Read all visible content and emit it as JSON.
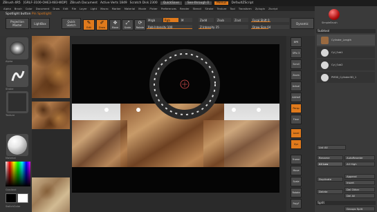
{
  "title_bar": {
    "app": "ZBrush 4R5",
    "doc_info": "[GRLF-3100-OHE3-X83-WDP]",
    "document": "ZBrush Document",
    "active_verts": "Active Verts 1849",
    "scratch": "Scratch Disk 2300",
    "quicksave": "QuickSave",
    "see_through": "See-through 0",
    "menus": "Menus",
    "script": "DefaultZScript"
  },
  "menu_items": [
    "Alpha",
    "Brush",
    "Color",
    "Document",
    "Draw",
    "Edit",
    "File",
    "Layer",
    "Light",
    "Macro",
    "Marker",
    "Material",
    "Movie",
    "Picker",
    "Preferences",
    "Render",
    "Stencil",
    "Stroke",
    "Texture",
    "Tool",
    "Transform",
    "Zplugin",
    "Zscript"
  ],
  "shelf": {
    "title": "Spotlight button",
    "title_highlight": "Pin Spotlight",
    "projection": "Projection Master",
    "lightbox": "LightBox",
    "quick_sketch": "Quick Sketch",
    "tools": [
      {
        "label": "Edit",
        "icon": "✎",
        "on": true
      },
      {
        "label": "Draw",
        "icon": "✐",
        "on": true
      },
      {
        "label": "Move",
        "icon": "✥",
        "on": false
      },
      {
        "label": "Scale",
        "icon": "⤢",
        "on": false
      },
      {
        "label": "Rotate",
        "icon": "⟳",
        "on": false
      }
    ],
    "rgb_label": "Mrgb",
    "rgb_value": "Rgb",
    "m_label": "M",
    "zadd": "Zadd",
    "zsub": "Zsub",
    "zcut": "Zcut",
    "rgb_intensity": "Rgb Intensity 100",
    "z_intensity": "Z Intensity 25",
    "focal_shift": "Focal Shift 0",
    "draw_size": "Draw Size 64",
    "dynamic": "Dynamic"
  },
  "left_tray": {
    "alpha_label": "Alpha",
    "stroke_label": "Stroke",
    "texture_label": "Texture",
    "material_label": "Material",
    "gradient_label": "Gradient",
    "switch_label": "SwitchColor",
    "alternate_label": "Alternate"
  },
  "right_tray": [
    {
      "label": "BPR",
      "on": false
    },
    {
      "label": "SPix 3",
      "on": false
    },
    {
      "label": "Scroll",
      "on": false
    },
    {
      "label": "Zoom",
      "on": false
    },
    {
      "label": "Actual",
      "on": false
    },
    {
      "label": "AAHalf",
      "on": false
    },
    {
      "label": "Persp",
      "on": true
    },
    {
      "label": "Floor",
      "on": false
    },
    {
      "label": "Local",
      "on": true
    },
    {
      "label": "Xyz",
      "on": true
    },
    {
      "label": "Frame",
      "on": false
    },
    {
      "label": "Move",
      "on": false
    },
    {
      "label": "Scale",
      "on": false
    },
    {
      "label": "Rotate",
      "on": false
    },
    {
      "label": "PolyF",
      "on": false
    }
  ],
  "subtool_panel": {
    "top_label": "SimpleBrush",
    "title": "Subtool",
    "subtools": [
      {
        "name": "Cylinder_Length",
        "selected": true
      },
      {
        "name": "Cyl_Sub1",
        "selected": false
      },
      {
        "name": "Cyl_Sub2",
        "selected": false
      },
      {
        "name": "PM3D_Cylinder3D_1",
        "selected": false
      }
    ],
    "buttons": {
      "list_all": "List All",
      "rename": "Rename",
      "auto_reorder": "AutoReorder",
      "all_low": "All Low",
      "all_high": "All High",
      "duplicate": "Duplicate",
      "append": "Append",
      "insert": "Insert",
      "delete": "Delete",
      "del_other": "Del Other",
      "del_all": "Del All",
      "split": "Split",
      "groups_split": "Groups Split"
    }
  },
  "colors": {
    "accent": "#e07a1c",
    "panel": "#3a3a3a",
    "viewport": "#050505"
  },
  "spotlight_wheel": {
    "center": "crosshair"
  }
}
